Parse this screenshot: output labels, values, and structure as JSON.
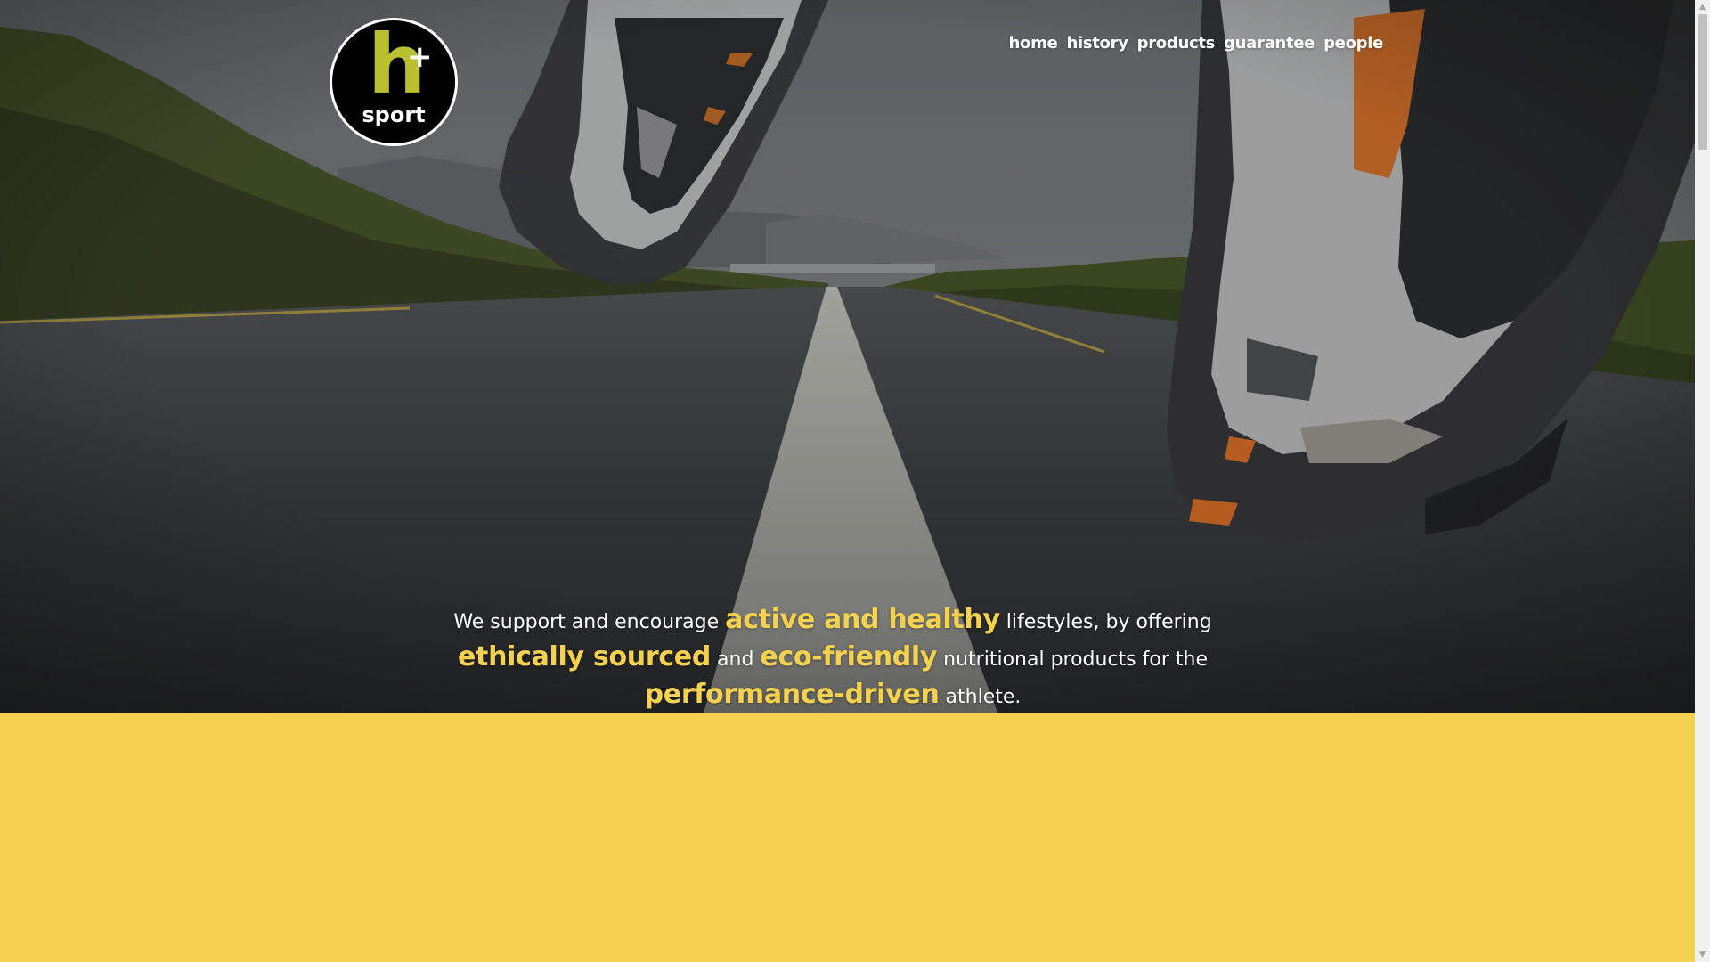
{
  "brand": {
    "logo_letter": "h",
    "logo_plus": "+",
    "logo_word": "sport"
  },
  "nav": {
    "items": [
      {
        "label": "home"
      },
      {
        "label": "history"
      },
      {
        "label": "products"
      },
      {
        "label": "guarantee"
      },
      {
        "label": "people"
      }
    ]
  },
  "tagline": {
    "t1": "We support and encourage",
    "h1": "active and healthy",
    "t2": "lifestyles, by offering",
    "h2": "ethically sourced",
    "t3": "and",
    "h3": "eco-friendly",
    "t4": "nutritional products for the",
    "h4": "performance-driven",
    "t5": "athlete."
  },
  "colors": {
    "accent": "#f4d24f",
    "logo_green": "#b9c130",
    "logo_bg": "#000000",
    "nav_text": "#ffffff"
  },
  "scrollbar": {
    "up_icon": "triangle-up",
    "down_icon": "triangle-down"
  }
}
